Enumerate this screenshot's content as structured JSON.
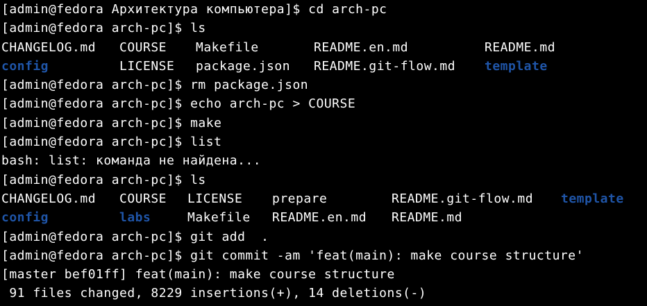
{
  "theme": {
    "background": "#000000",
    "foreground": "#ffffff",
    "directory_color": "#1f55a8"
  },
  "terminal": {
    "lines": [
      {
        "type": "command",
        "prompt": "[admin@fedora Архитектура компьютера]$ ",
        "command": "cd arch-pc"
      },
      {
        "type": "command",
        "prompt": "[admin@fedora arch-pc]$ ",
        "command": "ls"
      },
      {
        "type": "listing",
        "cells": [
          {
            "text": "CHANGELOG.md",
            "kind": "file"
          },
          {
            "text": "COURSE",
            "kind": "file"
          },
          {
            "text": "Makefile",
            "kind": "file"
          },
          {
            "text": "README.en.md",
            "kind": "file"
          },
          {
            "text": "README.md",
            "kind": "file"
          }
        ]
      },
      {
        "type": "listing",
        "cells": [
          {
            "text": "config",
            "kind": "dir"
          },
          {
            "text": "LICENSE",
            "kind": "file"
          },
          {
            "text": "package.json",
            "kind": "file"
          },
          {
            "text": "README.git-flow.md",
            "kind": "file"
          },
          {
            "text": "template",
            "kind": "dir"
          }
        ]
      },
      {
        "type": "command",
        "prompt": "[admin@fedora arch-pc]$ ",
        "command": "rm package.json"
      },
      {
        "type": "command",
        "prompt": "[admin@fedora arch-pc]$ ",
        "command": "echo arch-pc > COURSE"
      },
      {
        "type": "command",
        "prompt": "[admin@fedora arch-pc]$ ",
        "command": "make"
      },
      {
        "type": "command",
        "prompt": "[admin@fedora arch-pc]$ ",
        "command": "list"
      },
      {
        "type": "output",
        "text": "bash: list: команда не найдена..."
      },
      {
        "type": "command",
        "prompt": "[admin@fedora arch-pc]$ ",
        "command": "ls"
      },
      {
        "type": "listing",
        "cells": [
          {
            "text": "CHANGELOG.md",
            "kind": "file"
          },
          {
            "text": "COURSE",
            "kind": "file"
          },
          {
            "text": "LICENSE",
            "kind": "file"
          },
          {
            "text": "prepare",
            "kind": "file"
          },
          {
            "text": "README.git-flow.md",
            "kind": "file"
          },
          {
            "text": "template",
            "kind": "dir"
          }
        ]
      },
      {
        "type": "listing",
        "cells": [
          {
            "text": "config",
            "kind": "dir"
          },
          {
            "text": "labs",
            "kind": "dir"
          },
          {
            "text": "Makefile",
            "kind": "file"
          },
          {
            "text": "README.en.md",
            "kind": "file"
          },
          {
            "text": "README.md",
            "kind": "file"
          }
        ]
      },
      {
        "type": "command",
        "prompt": "[admin@fedora arch-pc]$ ",
        "command": "git add  ."
      },
      {
        "type": "command",
        "prompt": "[admin@fedora arch-pc]$ ",
        "command": "git commit -am 'feat(main): make course structure'"
      },
      {
        "type": "output",
        "text": "[master bef01ff] feat(main): make course structure"
      },
      {
        "type": "output",
        "text": " 91 files changed, 8229 insertions(+), 14 deletions(-)"
      }
    ]
  }
}
